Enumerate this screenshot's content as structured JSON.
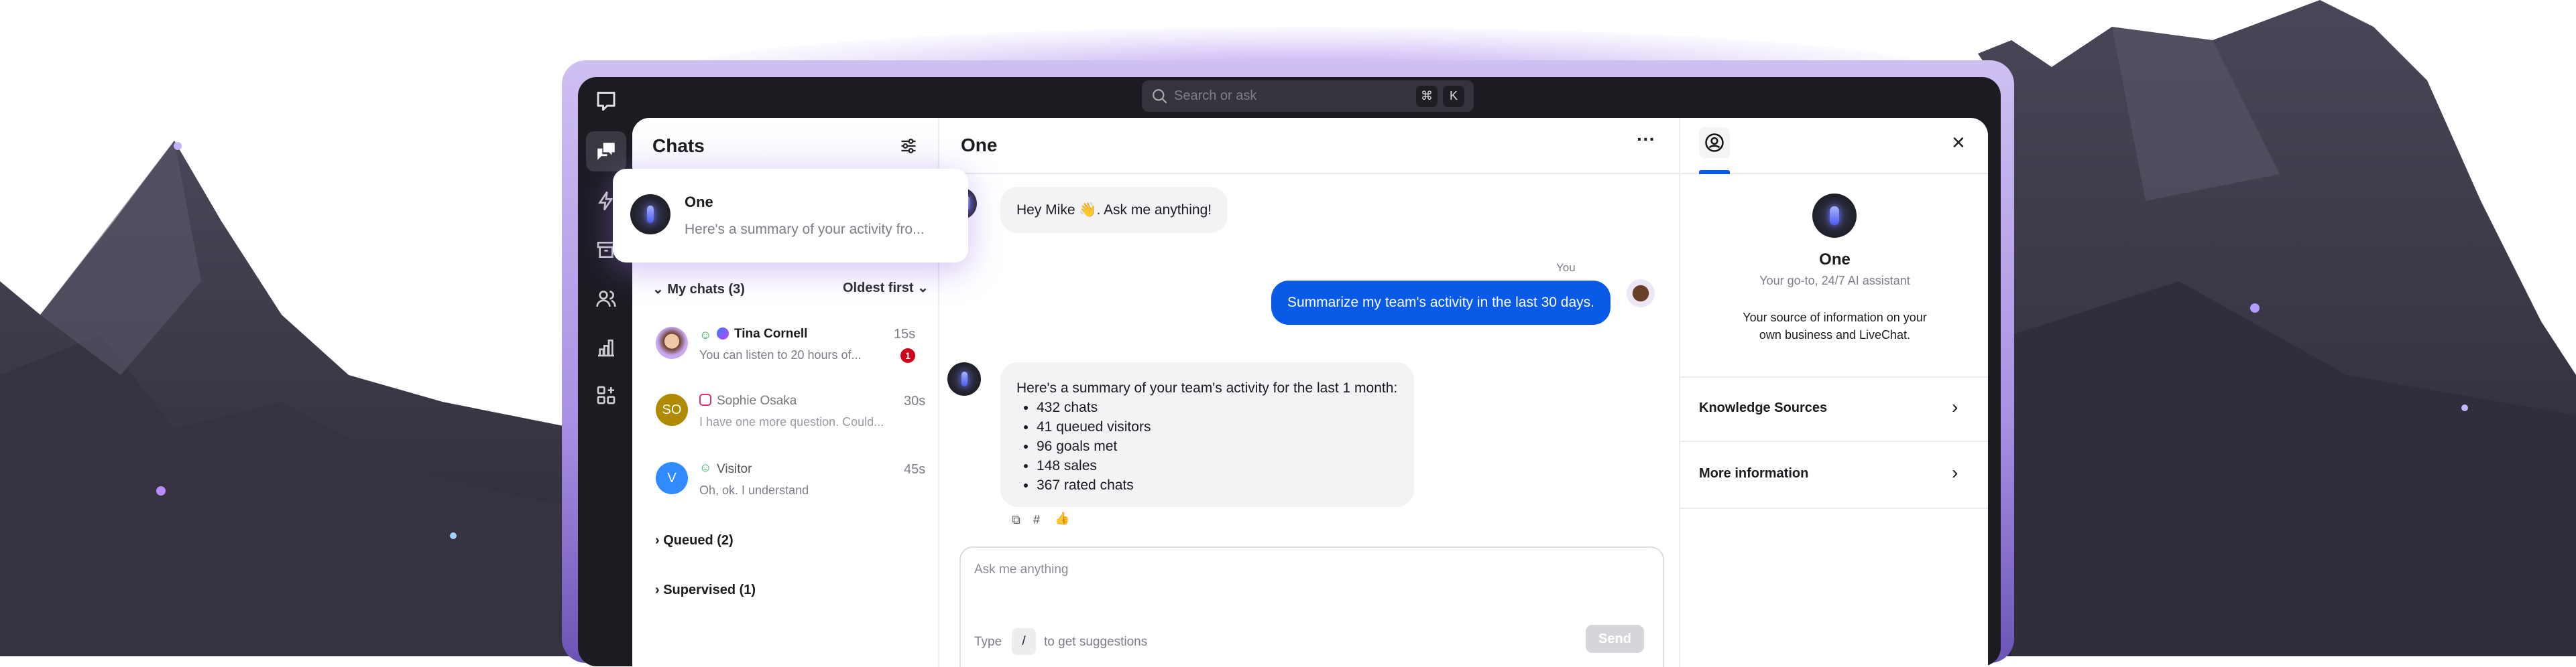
{
  "colors": {
    "accent": "#0a5ae8",
    "badge": "#d0021b",
    "frame": "#a990e4",
    "window": "#1c1b22"
  },
  "search": {
    "placeholder": "Search or ask",
    "key1": "⌘",
    "key2": "K"
  },
  "rail": {
    "items": [
      {
        "icon": "livechat-logo-icon"
      },
      {
        "icon": "chats-icon",
        "active": true
      },
      {
        "icon": "lightning-icon"
      },
      {
        "icon": "archive-icon"
      },
      {
        "icon": "team-icon"
      },
      {
        "icon": "reports-icon"
      },
      {
        "icon": "apps-icon"
      }
    ]
  },
  "chats": {
    "title": "Chats",
    "pinned": {
      "name": "One",
      "preview": "Here's a summary of your activity fro..."
    },
    "group": "My chats (3)",
    "sort": "Oldest first",
    "items": [
      {
        "name": "Tina Cornell",
        "preview": "You can listen to 20 hours of...",
        "time": "15s",
        "unread": "1",
        "initials": "",
        "channel": "messenger"
      },
      {
        "name": "Sophie Osaka",
        "preview": "I have one more question. Could...",
        "time": "30s",
        "initials": "SO",
        "channel": "instagram"
      },
      {
        "name": "Visitor",
        "preview": "Oh, ok. I understand",
        "time": "45s",
        "initials": "V",
        "channel": "chat"
      }
    ],
    "queued": "Queued (2)",
    "supervised": "Supervised (1)"
  },
  "conversation": {
    "title": "One",
    "messages": [
      {
        "from": "bot",
        "text": "Hey Mike 👋. Ask me anything!"
      },
      {
        "from": "user",
        "label": "You",
        "text": "Summarize my team's activity in the last 30 days."
      },
      {
        "from": "bot",
        "text": "Here's a summary of your team's activity for the last 1 month:",
        "bullets": [
          "432 chats",
          "41 queued visitors",
          "96 goals met",
          "148 sales",
          "367 rated chats"
        ]
      }
    ],
    "composer": {
      "placeholder": "Ask me anything",
      "hint_pre": "Type",
      "hint_key": "/",
      "hint_post": "to get suggestions",
      "send": "Send"
    }
  },
  "details": {
    "name": "One",
    "subtitle": "Your go-to, 24/7 AI assistant",
    "description_1": "Your source of information on your",
    "description_2": "own business and LiveChat.",
    "sections": [
      "Knowledge Sources",
      "More information"
    ]
  }
}
